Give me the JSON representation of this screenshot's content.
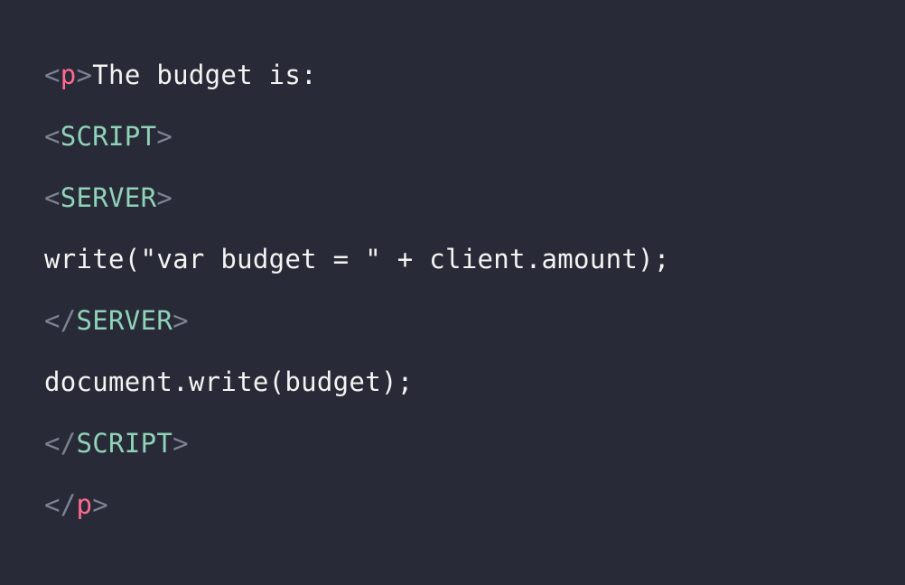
{
  "colors": {
    "background": "#282a37",
    "text": "#f4f4f2",
    "punctuation": "#7d8191",
    "html_tag": "#ff6b8f",
    "custom_tag": "#8fd3b8"
  },
  "lines": [
    {
      "open": "<",
      "tag": "p",
      "close": ">",
      "text": "The budget is:"
    },
    {
      "open": "<",
      "tag": "SCRIPT",
      "close": ">"
    },
    {
      "open": "<",
      "tag": "SERVER",
      "close": ">"
    },
    {
      "text": "write(\"var budget = \" + client.amount);"
    },
    {
      "open": "</",
      "tag": "SERVER",
      "close": ">"
    },
    {
      "text": "document.write(budget);"
    },
    {
      "open": "</",
      "tag": "SCRIPT",
      "close": ">"
    },
    {
      "open": "</",
      "tag": "p",
      "close": ">"
    }
  ]
}
